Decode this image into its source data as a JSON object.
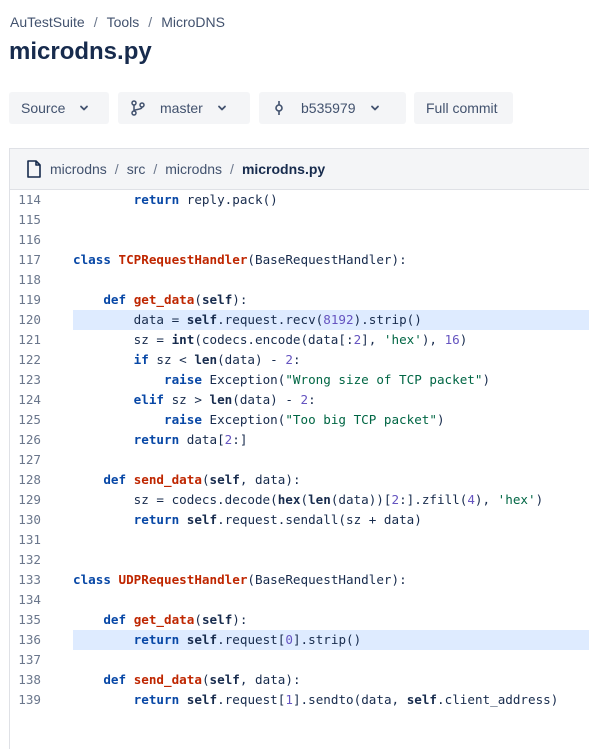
{
  "breadcrumb": {
    "items": [
      "AuTestSuite",
      "Tools",
      "MicroDNS"
    ]
  },
  "page_title": "microdns.py",
  "toolbar": {
    "source_label": "Source",
    "branch_label": "master",
    "commit_label": "b535979",
    "full_commit_label": "Full commit"
  },
  "file_path": {
    "parts": [
      "microdns",
      "src",
      "microdns",
      "microdns.py"
    ]
  },
  "code": {
    "highlighted_lines": [
      120,
      136
    ],
    "lines": [
      {
        "n": "114",
        "t": [
          [
            "        ",
            ""
          ],
          [
            "return",
            "kw"
          ],
          [
            " reply.pack()",
            ""
          ]
        ]
      },
      {
        "n": "115",
        "t": []
      },
      {
        "n": "116",
        "t": []
      },
      {
        "n": "117",
        "t": [
          [
            "class",
            "kw"
          ],
          [
            " ",
            ""
          ],
          [
            "TCPRequestHandler",
            "cls"
          ],
          [
            "(BaseRequestHandler):",
            ""
          ]
        ]
      },
      {
        "n": "118",
        "t": []
      },
      {
        "n": "119",
        "t": [
          [
            "    ",
            ""
          ],
          [
            "def",
            "kw"
          ],
          [
            " ",
            ""
          ],
          [
            "get_data",
            "fn"
          ],
          [
            "(",
            ""
          ],
          [
            "self",
            "bi"
          ],
          [
            "):",
            ""
          ]
        ]
      },
      {
        "n": "120",
        "t": [
          [
            "        data = ",
            ""
          ],
          [
            "self",
            "bi"
          ],
          [
            ".request.recv(",
            ""
          ],
          [
            "8192",
            "num"
          ],
          [
            ").strip()",
            ""
          ]
        ]
      },
      {
        "n": "121",
        "t": [
          [
            "        sz = ",
            ""
          ],
          [
            "int",
            "bi"
          ],
          [
            "(codecs.encode(data[:",
            ""
          ],
          [
            "2",
            "num"
          ],
          [
            "], ",
            ""
          ],
          [
            "'hex'",
            "str"
          ],
          [
            "), ",
            ""
          ],
          [
            "16",
            "num"
          ],
          [
            ")",
            ""
          ]
        ]
      },
      {
        "n": "122",
        "t": [
          [
            "        ",
            ""
          ],
          [
            "if",
            "kw"
          ],
          [
            " sz < ",
            ""
          ],
          [
            "len",
            "bi"
          ],
          [
            "(data) - ",
            ""
          ],
          [
            "2",
            "num"
          ],
          [
            ":",
            ""
          ]
        ]
      },
      {
        "n": "123",
        "t": [
          [
            "            ",
            ""
          ],
          [
            "raise",
            "kw"
          ],
          [
            " Exception(",
            ""
          ],
          [
            "\"Wrong size of TCP packet\"",
            "str"
          ],
          [
            ")",
            ""
          ]
        ]
      },
      {
        "n": "124",
        "t": [
          [
            "        ",
            ""
          ],
          [
            "elif",
            "kw"
          ],
          [
            " sz > ",
            ""
          ],
          [
            "len",
            "bi"
          ],
          [
            "(data) - ",
            ""
          ],
          [
            "2",
            "num"
          ],
          [
            ":",
            ""
          ]
        ]
      },
      {
        "n": "125",
        "t": [
          [
            "            ",
            ""
          ],
          [
            "raise",
            "kw"
          ],
          [
            " Exception(",
            ""
          ],
          [
            "\"Too big TCP packet\"",
            "str"
          ],
          [
            ")",
            ""
          ]
        ]
      },
      {
        "n": "126",
        "t": [
          [
            "        ",
            ""
          ],
          [
            "return",
            "kw"
          ],
          [
            " data[",
            ""
          ],
          [
            "2",
            "num"
          ],
          [
            ":]",
            ""
          ]
        ]
      },
      {
        "n": "127",
        "t": []
      },
      {
        "n": "128",
        "t": [
          [
            "    ",
            ""
          ],
          [
            "def",
            "kw"
          ],
          [
            " ",
            ""
          ],
          [
            "send_data",
            "fn"
          ],
          [
            "(",
            ""
          ],
          [
            "self",
            "bi"
          ],
          [
            ", data):",
            ""
          ]
        ]
      },
      {
        "n": "129",
        "t": [
          [
            "        sz = codecs.decode(",
            ""
          ],
          [
            "hex",
            "bi"
          ],
          [
            "(",
            ""
          ],
          [
            "len",
            "bi"
          ],
          [
            "(data))[",
            ""
          ],
          [
            "2",
            "num"
          ],
          [
            ":].zfill(",
            ""
          ],
          [
            "4",
            "num"
          ],
          [
            "), ",
            ""
          ],
          [
            "'hex'",
            "str"
          ],
          [
            ")",
            ""
          ]
        ]
      },
      {
        "n": "130",
        "t": [
          [
            "        ",
            ""
          ],
          [
            "return",
            "kw"
          ],
          [
            " ",
            ""
          ],
          [
            "self",
            "bi"
          ],
          [
            ".request.sendall(sz + data)",
            ""
          ]
        ]
      },
      {
        "n": "131",
        "t": []
      },
      {
        "n": "132",
        "t": []
      },
      {
        "n": "133",
        "t": [
          [
            "class",
            "kw"
          ],
          [
            " ",
            ""
          ],
          [
            "UDPRequestHandler",
            "cls"
          ],
          [
            "(BaseRequestHandler):",
            ""
          ]
        ]
      },
      {
        "n": "134",
        "t": []
      },
      {
        "n": "135",
        "t": [
          [
            "    ",
            ""
          ],
          [
            "def",
            "kw"
          ],
          [
            " ",
            ""
          ],
          [
            "get_data",
            "fn"
          ],
          [
            "(",
            ""
          ],
          [
            "self",
            "bi"
          ],
          [
            "):",
            ""
          ]
        ]
      },
      {
        "n": "136",
        "t": [
          [
            "        ",
            ""
          ],
          [
            "return",
            "kw"
          ],
          [
            " ",
            ""
          ],
          [
            "self",
            "bi"
          ],
          [
            ".request[",
            ""
          ],
          [
            "0",
            "num"
          ],
          [
            "].strip()",
            ""
          ]
        ]
      },
      {
        "n": "137",
        "t": []
      },
      {
        "n": "138",
        "t": [
          [
            "    ",
            ""
          ],
          [
            "def",
            "kw"
          ],
          [
            " ",
            ""
          ],
          [
            "send_data",
            "fn"
          ],
          [
            "(",
            ""
          ],
          [
            "self",
            "bi"
          ],
          [
            ", data):",
            ""
          ]
        ]
      },
      {
        "n": "139",
        "t": [
          [
            "        ",
            ""
          ],
          [
            "return",
            "kw"
          ],
          [
            " ",
            ""
          ],
          [
            "self",
            "bi"
          ],
          [
            ".request[",
            ""
          ],
          [
            "1",
            "num"
          ],
          [
            "].sendto(data, ",
            ""
          ],
          [
            "self",
            "bi"
          ],
          [
            ".client_address)",
            ""
          ]
        ]
      }
    ]
  },
  "icons": {
    "source_chevron": "chevron-down-icon",
    "branch": "branch-icon",
    "commit": "commit-icon",
    "file": "file-icon"
  },
  "colors": {
    "keyword": "#0747a6",
    "class_name": "#bf2600",
    "string": "#006644",
    "number": "#6554c0",
    "highlight": "#deebff"
  }
}
